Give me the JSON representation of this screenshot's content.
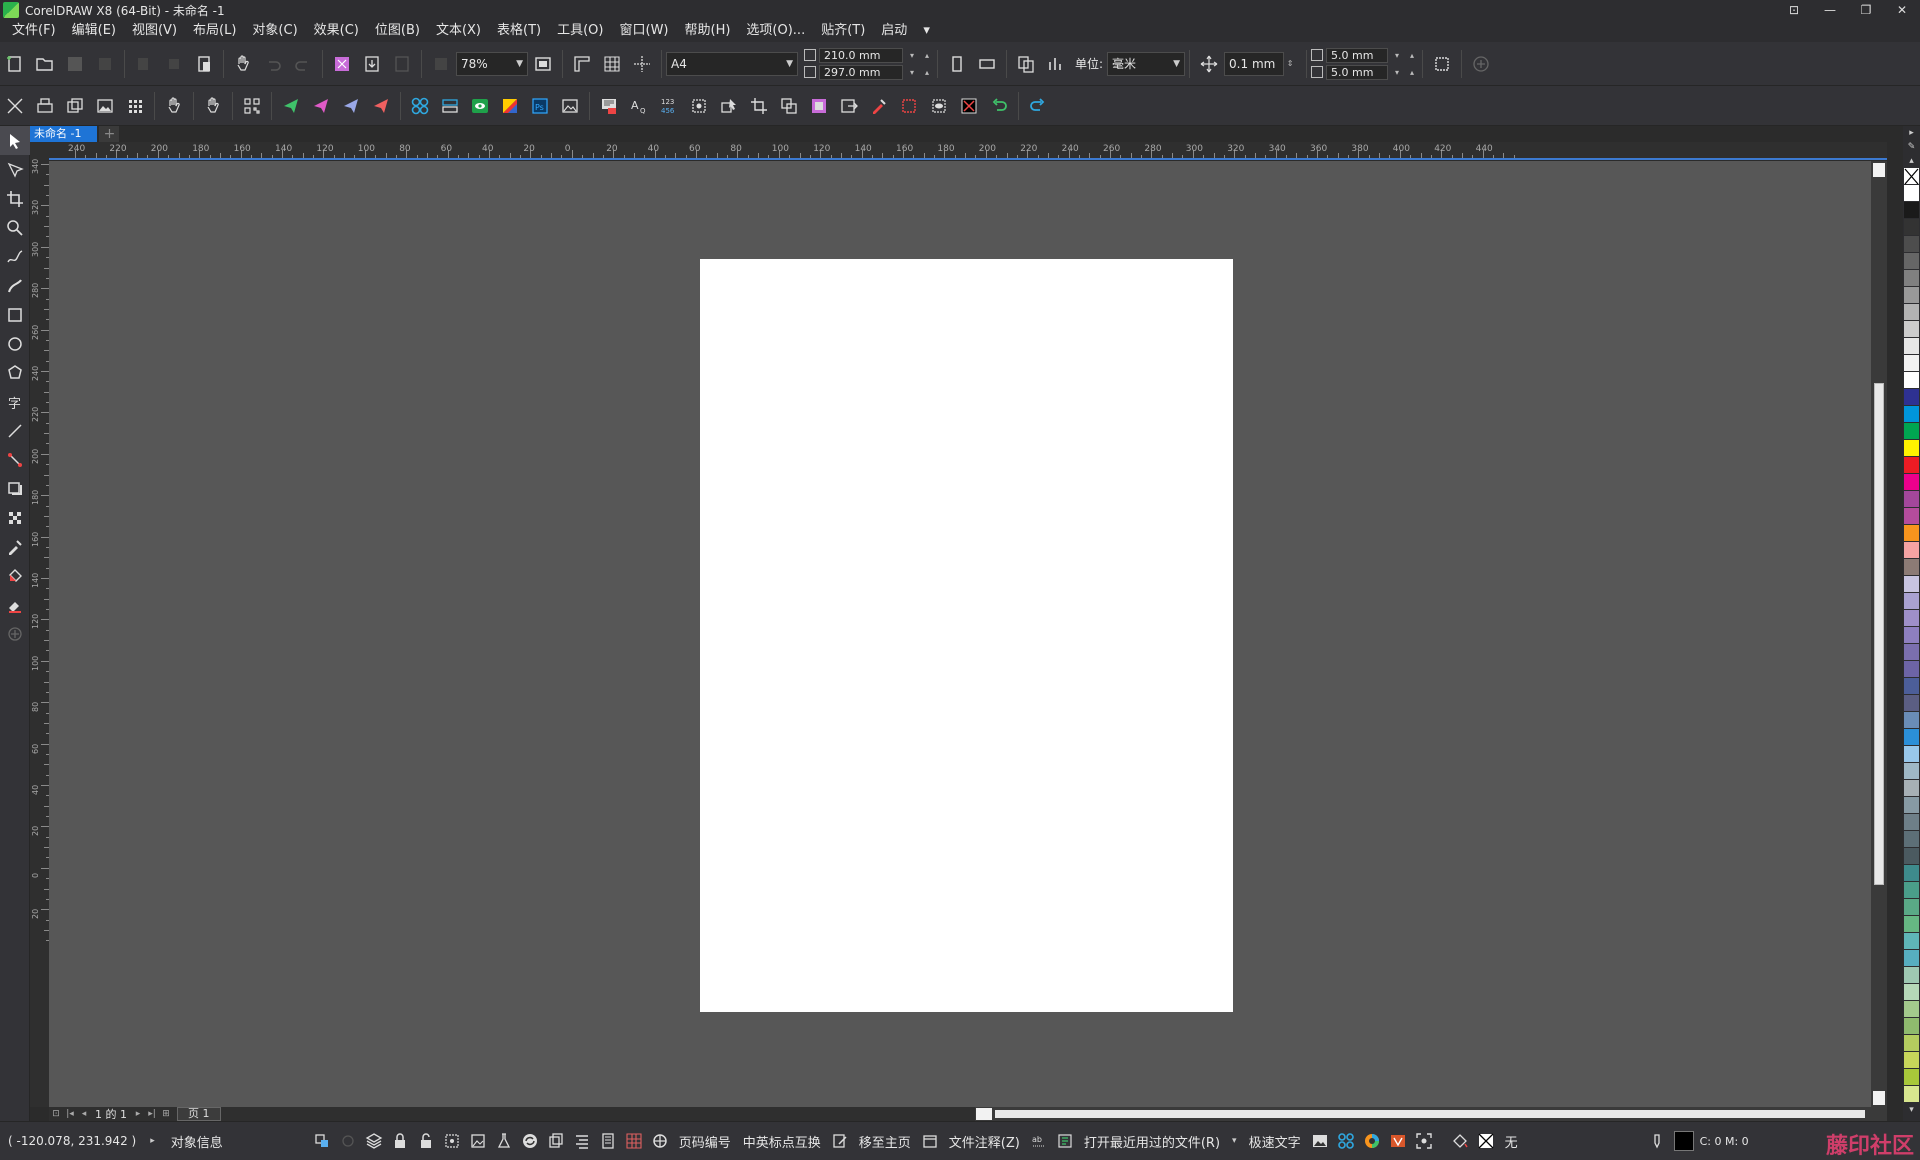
{
  "window": {
    "title": "CorelDRAW X8 (64-Bit) - 未命名 -1"
  },
  "menu": [
    "文件(F)",
    "编辑(E)",
    "视图(V)",
    "布局(L)",
    "对象(C)",
    "效果(C)",
    "位图(B)",
    "文本(X)",
    "表格(T)",
    "工具(O)",
    "窗口(W)",
    "帮助(H)",
    "选项(O)...",
    "贴齐(T)",
    "启动"
  ],
  "toolbar": {
    "zoom_value": "78%",
    "page_size": "A4",
    "width_value": "210.0 mm",
    "height_value": "297.0 mm",
    "unit_label": "单位:",
    "unit_value": "毫米",
    "nudge_value": "0.1 mm",
    "dup_x_value": "5.0 mm",
    "dup_y_value": "5.0 mm"
  },
  "document": {
    "tab_label": "未命名 -1"
  },
  "rulers": {
    "horizontal_labels": [
      "240",
      "220",
      "200",
      "180",
      "160",
      "140",
      "120",
      "100",
      "80",
      "60",
      "40",
      "20",
      "0",
      "20",
      "40",
      "60",
      "80",
      "100",
      "120",
      "140",
      "160",
      "180",
      "200",
      "220",
      "240",
      "260",
      "280",
      "300",
      "320",
      "340",
      "360",
      "380",
      "400",
      "420",
      "440"
    ],
    "vertical_labels": [
      "340",
      "320",
      "300",
      "280",
      "260",
      "240",
      "220",
      "200",
      "180",
      "160",
      "140",
      "120",
      "100",
      "80",
      "60",
      "40",
      "20",
      "0",
      "20"
    ]
  },
  "page_nav": {
    "counter": "1 的 1",
    "page_tab": "页 1"
  },
  "palette": {
    "colors": [
      "#ffffff",
      "#1a1a1a",
      "#333333",
      "#4d4d4d",
      "#666666",
      "#808080",
      "#999999",
      "#b3b3b3",
      "#cccccc",
      "#e6e6e6",
      "#f2f2f2",
      "#ffffff",
      "#2e3192",
      "#0095da",
      "#00a651",
      "#fff200",
      "#ed1c24",
      "#ec008c",
      "#a3479b",
      "#b44c9c",
      "#f7941d",
      "#f5a3a3",
      "#8c7b75",
      "#c8c4e0",
      "#a9a1d1",
      "#9e8fc8",
      "#8e7fbf",
      "#7b6fae",
      "#6d64a6",
      "#4c5e99",
      "#5b5e83",
      "#6a8db7",
      "#2b8fd8",
      "#98c7ea",
      "#9fb8c6",
      "#a7b0b5",
      "#879aa4",
      "#6e7f88",
      "#5d6f77",
      "#4b5a60",
      "#3e8b8c",
      "#4a9e8a",
      "#5aa986",
      "#66b783",
      "#5fb6b8",
      "#57aec0",
      "#9ec8b2",
      "#b6d8b8",
      "#a3c98c",
      "#8fba6e",
      "#b4cc5f",
      "#c8d65a",
      "#a8c83a",
      "#d8e68f"
    ]
  },
  "status": {
    "coordinates": "( -120.078, 231.942 )",
    "object_info": "对象信息",
    "page_number": "页码编号",
    "punct_swap": "中英标点互换",
    "move_to_master": "移至主页",
    "file_notes": "文件注释(Z)",
    "recent_files": "打开最近用过的文件(R)",
    "fast_text": "极速文字",
    "fill_none": "无",
    "color_values": "C: 0 M: 0"
  },
  "watermark": "藤印社区",
  "accent": "#1e74d6"
}
